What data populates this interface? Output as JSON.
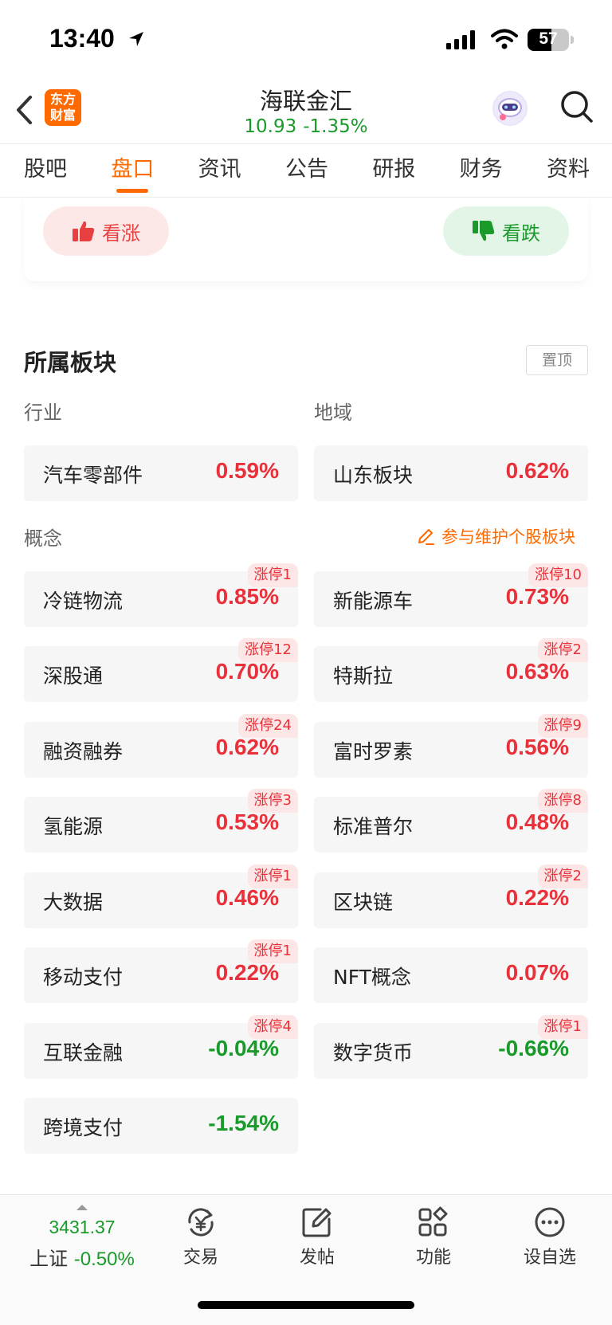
{
  "status_bar": {
    "time": "13:40",
    "battery": "57",
    "battery_level": 0.57
  },
  "header": {
    "logo_line1": "东方",
    "logo_line2": "财富",
    "stock_name": "海联金汇",
    "price": "10.93",
    "change": "-1.35%"
  },
  "tabs": [
    {
      "label": "股吧"
    },
    {
      "label": "盘口",
      "active": true
    },
    {
      "label": "资讯"
    },
    {
      "label": "公告"
    },
    {
      "label": "研报"
    },
    {
      "label": "财务"
    },
    {
      "label": "资料"
    }
  ],
  "vote": {
    "up_label": "看涨",
    "down_label": "看跌"
  },
  "sectors": {
    "title": "所属板块",
    "pin_label": "置顶",
    "industry_label": "行业",
    "region_label": "地域",
    "concept_label": "概念",
    "maintain_label": "参与维护个股板块",
    "industry": {
      "name": "汽车零部件",
      "value": "0.59%"
    },
    "region": {
      "name": "山东板块",
      "value": "0.62%"
    },
    "concepts": [
      {
        "name": "冷链物流",
        "value": "0.85%",
        "badge": "涨停1"
      },
      {
        "name": "新能源车",
        "value": "0.73%",
        "badge": "涨停10"
      },
      {
        "name": "深股通",
        "value": "0.70%",
        "badge": "涨停12"
      },
      {
        "name": "特斯拉",
        "value": "0.63%",
        "badge": "涨停2"
      },
      {
        "name": "融资融券",
        "value": "0.62%",
        "badge": "涨停24"
      },
      {
        "name": "富时罗素",
        "value": "0.56%",
        "badge": "涨停9"
      },
      {
        "name": "氢能源",
        "value": "0.53%",
        "badge": "涨停3"
      },
      {
        "name": "标准普尔",
        "value": "0.48%",
        "badge": "涨停8"
      },
      {
        "name": "大数据",
        "value": "0.46%",
        "badge": "涨停1"
      },
      {
        "name": "区块链",
        "value": "0.22%",
        "badge": "涨停2"
      },
      {
        "name": "移动支付",
        "value": "0.22%",
        "badge": "涨停1"
      },
      {
        "name": "NFT概念",
        "value": "0.07%",
        "badge": ""
      },
      {
        "name": "互联金融",
        "value": "-0.04%",
        "badge": "涨停4"
      },
      {
        "name": "数字货币",
        "value": "-0.66%",
        "badge": "涨停1"
      },
      {
        "name": "跨境支付",
        "value": "-1.54%",
        "badge": ""
      }
    ]
  },
  "bottom_bar": {
    "index_value": "3431.37",
    "index_name": "上证",
    "index_change": "-0.50%",
    "nav": [
      {
        "label": "交易",
        "icon": "trade-icon"
      },
      {
        "label": "发帖",
        "icon": "post-icon"
      },
      {
        "label": "功能",
        "icon": "apps-icon"
      },
      {
        "label": "设自选",
        "icon": "more-icon"
      }
    ]
  },
  "colors": {
    "accent": "#ff6a00",
    "up": "#e8313a",
    "down": "#1a9a2a"
  }
}
